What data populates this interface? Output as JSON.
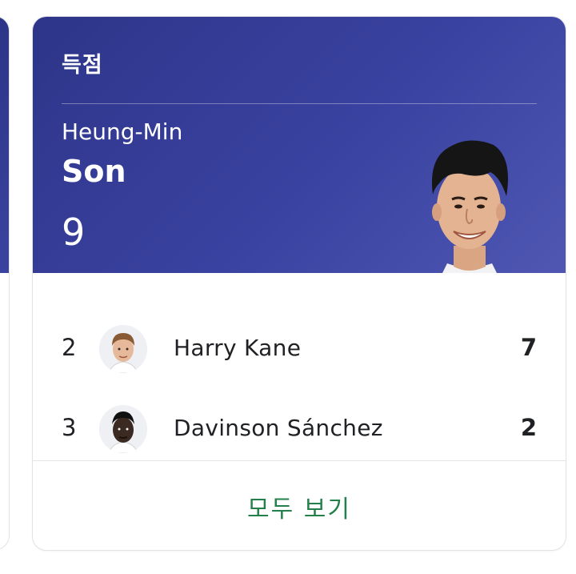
{
  "card": {
    "title": "득점",
    "leader": {
      "first_name": "Heung-Min",
      "last_name": "Son",
      "value": "9"
    },
    "rows": [
      {
        "rank": "2",
        "name": "Harry Kane",
        "value": "7"
      },
      {
        "rank": "3",
        "name": "Davinson Sánchez",
        "value": "2"
      }
    ],
    "see_all_label": "모두 보기"
  },
  "colors": {
    "hero_gradient_start": "#2d3589",
    "hero_gradient_end": "#4f57b3",
    "link_green": "#23804a",
    "text_dark": "#202124"
  }
}
